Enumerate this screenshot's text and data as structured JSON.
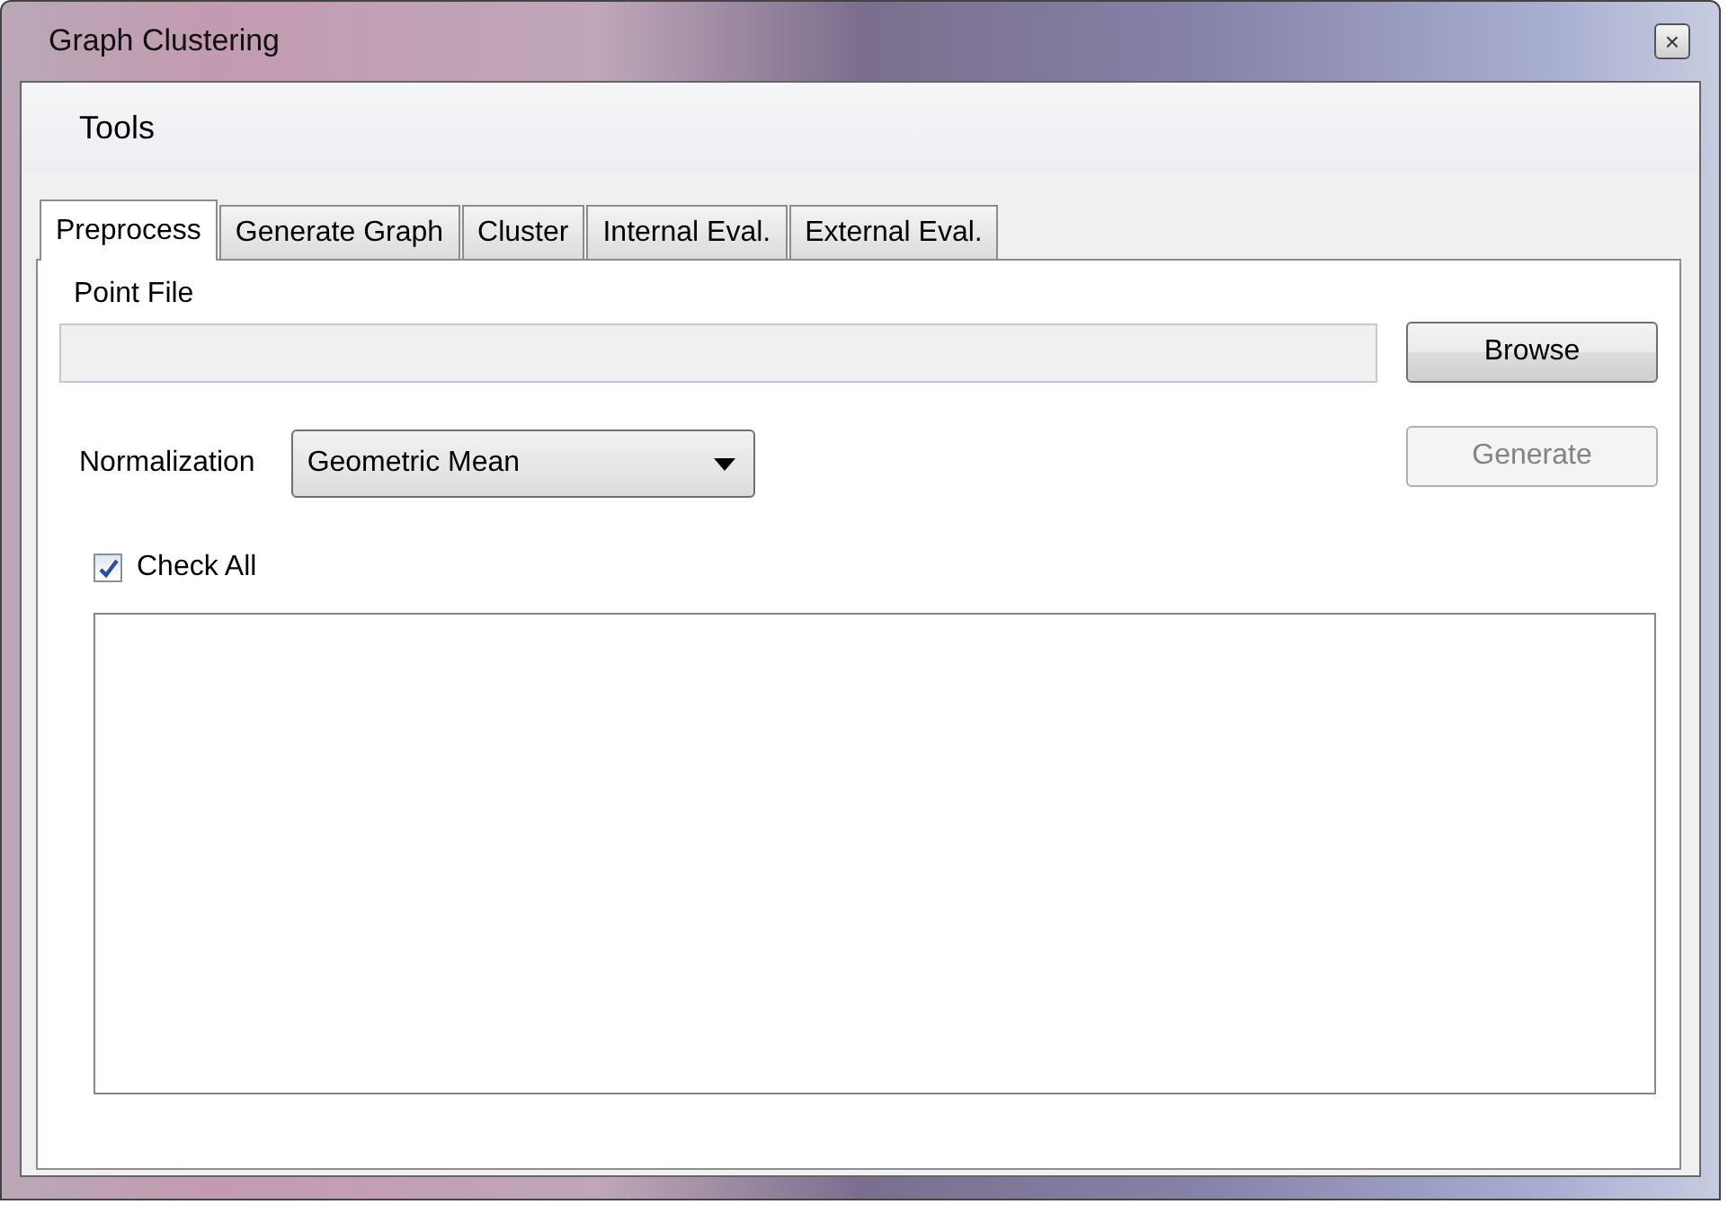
{
  "window": {
    "title": "Graph Clustering",
    "close": "×"
  },
  "menu": [
    {
      "label": "Tools"
    }
  ],
  "tabs": [
    {
      "label": "Preprocess",
      "selected": true
    },
    {
      "label": "Generate Graph",
      "selected": false
    },
    {
      "label": "Cluster",
      "selected": false
    },
    {
      "label": "Internal Eval.",
      "selected": false
    },
    {
      "label": "External Eval.",
      "selected": false
    }
  ],
  "point_file": {
    "label": "Point File",
    "browse": {
      "label": "Browse",
      "disabled": false
    }
  },
  "normalization": {
    "label": "Normalization",
    "value": "Geometric Mean",
    "generate": {
      "label": "Generate",
      "disabled": true
    }
  },
  "check_all": {
    "label": "Check All",
    "checked": true
  }
}
